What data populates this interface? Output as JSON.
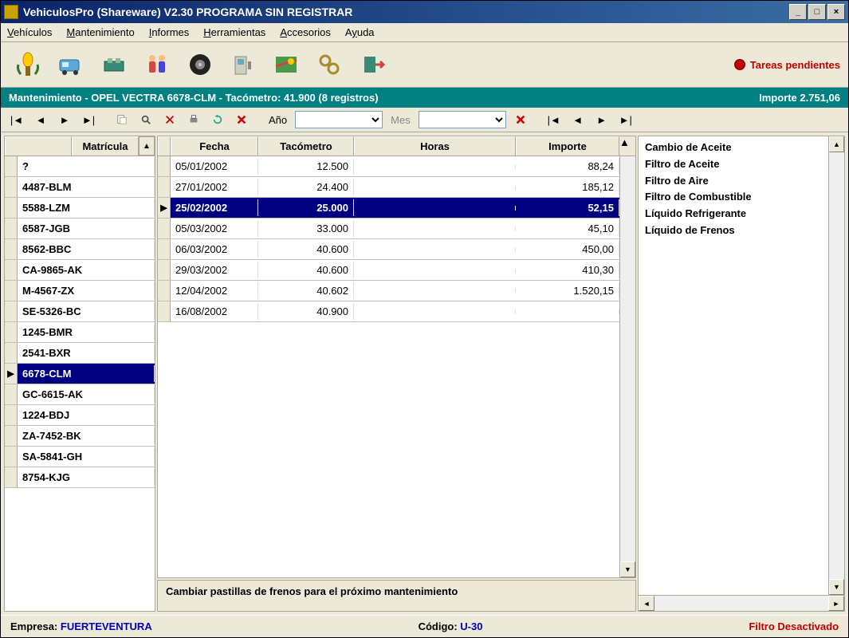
{
  "window": {
    "title": "VehiculosPro (Shareware) V2.30 PROGRAMA SIN REGISTRAR"
  },
  "menu": {
    "vehiculos": "Vehículos",
    "mantenimiento": "Mantenimiento",
    "informes": "Informes",
    "herramientas": "Herramientas",
    "accesorios": "Accesorios",
    "ayuda": "Ayuda"
  },
  "toolbar": {
    "pending_label": "Tareas pendientes"
  },
  "context": {
    "text": "Mantenimiento - OPEL VECTRA 6678-CLM  - Tacómetro: 41.900 (8 registros)",
    "importe_label": "Importe 2.751,06"
  },
  "navbar": {
    "ano_label": "Año",
    "mes_label": "Mes"
  },
  "matriculas": {
    "header": "Matrícula",
    "selected_index": 10,
    "items": [
      "?",
      "4487-BLM",
      "5588-LZM",
      "6587-JGB",
      "8562-BBC",
      "CA-9865-AK",
      "M-4567-ZX",
      "SE-5326-BC",
      "1245-BMR",
      "2541-BXR",
      "6678-CLM",
      "GC-6615-AK",
      "1224-BDJ",
      "ZA-7452-BK",
      "SA-5841-GH",
      "8754-KJG"
    ]
  },
  "table": {
    "headers": {
      "fecha": "Fecha",
      "tacometro": "Tacómetro",
      "horas": "Horas",
      "importe": "Importe"
    },
    "selected_index": 2,
    "rows": [
      {
        "fecha": "05/01/2002",
        "tacometro": "12.500",
        "horas": "",
        "importe": "88,24"
      },
      {
        "fecha": "27/01/2002",
        "tacometro": "24.400",
        "horas": "",
        "importe": "185,12"
      },
      {
        "fecha": "25/02/2002",
        "tacometro": "25.000",
        "horas": "",
        "importe": "52,15"
      },
      {
        "fecha": "05/03/2002",
        "tacometro": "33.000",
        "horas": "",
        "importe": "45,10"
      },
      {
        "fecha": "06/03/2002",
        "tacometro": "40.600",
        "horas": "",
        "importe": "450,00"
      },
      {
        "fecha": "29/03/2002",
        "tacometro": "40.600",
        "horas": "",
        "importe": "410,30"
      },
      {
        "fecha": "12/04/2002",
        "tacometro": "40.602",
        "horas": "",
        "importe": "1.520,15"
      },
      {
        "fecha": "16/08/2002",
        "tacometro": "40.900",
        "horas": "",
        "importe": ""
      }
    ]
  },
  "details": {
    "items": [
      "Cambio de Aceite",
      "Filtro de Aceite",
      "Filtro de Aire",
      "Filtro de Combustible",
      "Líquido Refrigerante",
      "Líquido de Frenos"
    ]
  },
  "note": {
    "text": "Cambiar pastillas de frenos para el próximo mantenimiento"
  },
  "status": {
    "empresa_label": "Empresa:",
    "empresa_value": "FUERTEVENTURA",
    "codigo_label": "Código:",
    "codigo_value": "U-30",
    "filter": "Filtro Desactivado"
  }
}
